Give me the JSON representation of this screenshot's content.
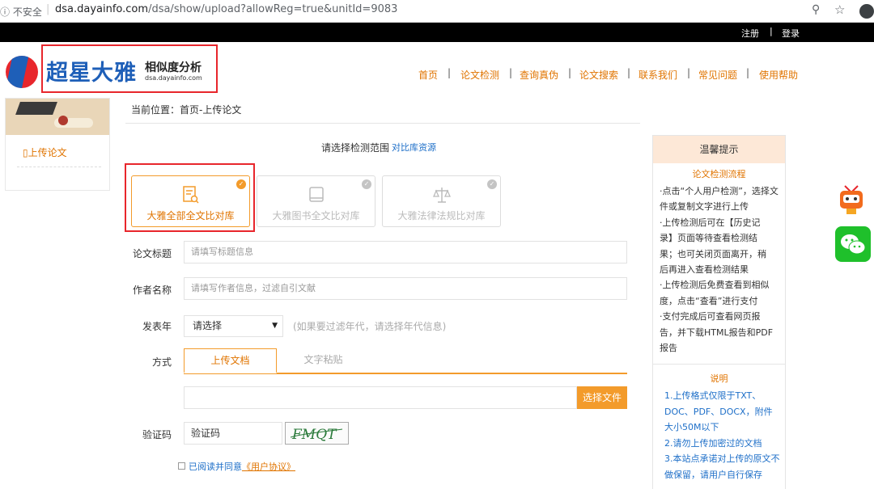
{
  "browser": {
    "security_label": "ⓘ 不安全",
    "host": "dsa.dayainfo.com",
    "path": "/dsa/show/upload?allowReg=true&unitId=9083"
  },
  "topbar": {
    "register": "注册",
    "separator": "|",
    "login": "登录"
  },
  "logo": {
    "name": "超星大雅",
    "subtitle": "相似度分析",
    "domain": "dsa.dayainfo.com"
  },
  "nav": {
    "items": [
      "首页",
      "论文检测",
      "查询真伪",
      "论文搜索",
      "联系我们",
      "常见问题",
      "使用帮助"
    ],
    "separator": "|"
  },
  "sidebar": {
    "item": "上传论文"
  },
  "breadcrumb": "当前位置：首页-上传论文",
  "range": {
    "label": "请选择检测范围",
    "link": "对比库资源"
  },
  "cards": [
    {
      "label": "大雅全部全文比对库",
      "active": true
    },
    {
      "label": "大雅图书全文比对库",
      "active": false
    },
    {
      "label": "大雅法律法规比对库",
      "active": false
    }
  ],
  "form": {
    "title_label": "论文标题",
    "title_placeholder": "请填写标题信息",
    "author_label": "作者名称",
    "author_placeholder": "请填写作者信息，过滤自引文献",
    "year_label": "发表年",
    "year_value": "请选择",
    "year_hint": "(如果要过滤年代，请选择年代信息)",
    "method_label": "方式",
    "tab_upload": "上传文档",
    "tab_paste": "文字粘贴",
    "file_button": "选择文件",
    "captcha_label": "验证码",
    "captcha_value": "验证码",
    "captcha_image_text": "FMQT",
    "agree_text": "已阅读并同意",
    "agree_link": "《用户协议》"
  },
  "tips": {
    "title": "温馨提示",
    "process_title": "论文检测流程",
    "process_lines": [
      "·点击“个人用户检测”，选择文",
      "件或复制文字进行上传",
      "·上传检测后可在【历史记",
      "录】页面等待查看检测结",
      "果；也可关闭页面离开，稍",
      "后再进入查看检测结果",
      "·上传检测后免费查看到相似",
      "度，点击“查看”进行支付",
      "·支付完成后可查看网页报",
      "告，并下载HTML报告和PDF",
      "报告"
    ],
    "note_title": "说明",
    "note_lines": [
      "1.上传格式仅限于TXT、",
      "DOC、PDF、DOCX，附件",
      "大小50M以下",
      "2.请勿上传加密过的文档",
      "3.本站点承诺对上传的原文不",
      "做保留，请用户自行保存"
    ]
  },
  "colors": {
    "accent": "#f39b2b",
    "link": "#1e6fc8",
    "brand_red": "#e8262c",
    "brand_blue": "#1e5fb8"
  }
}
